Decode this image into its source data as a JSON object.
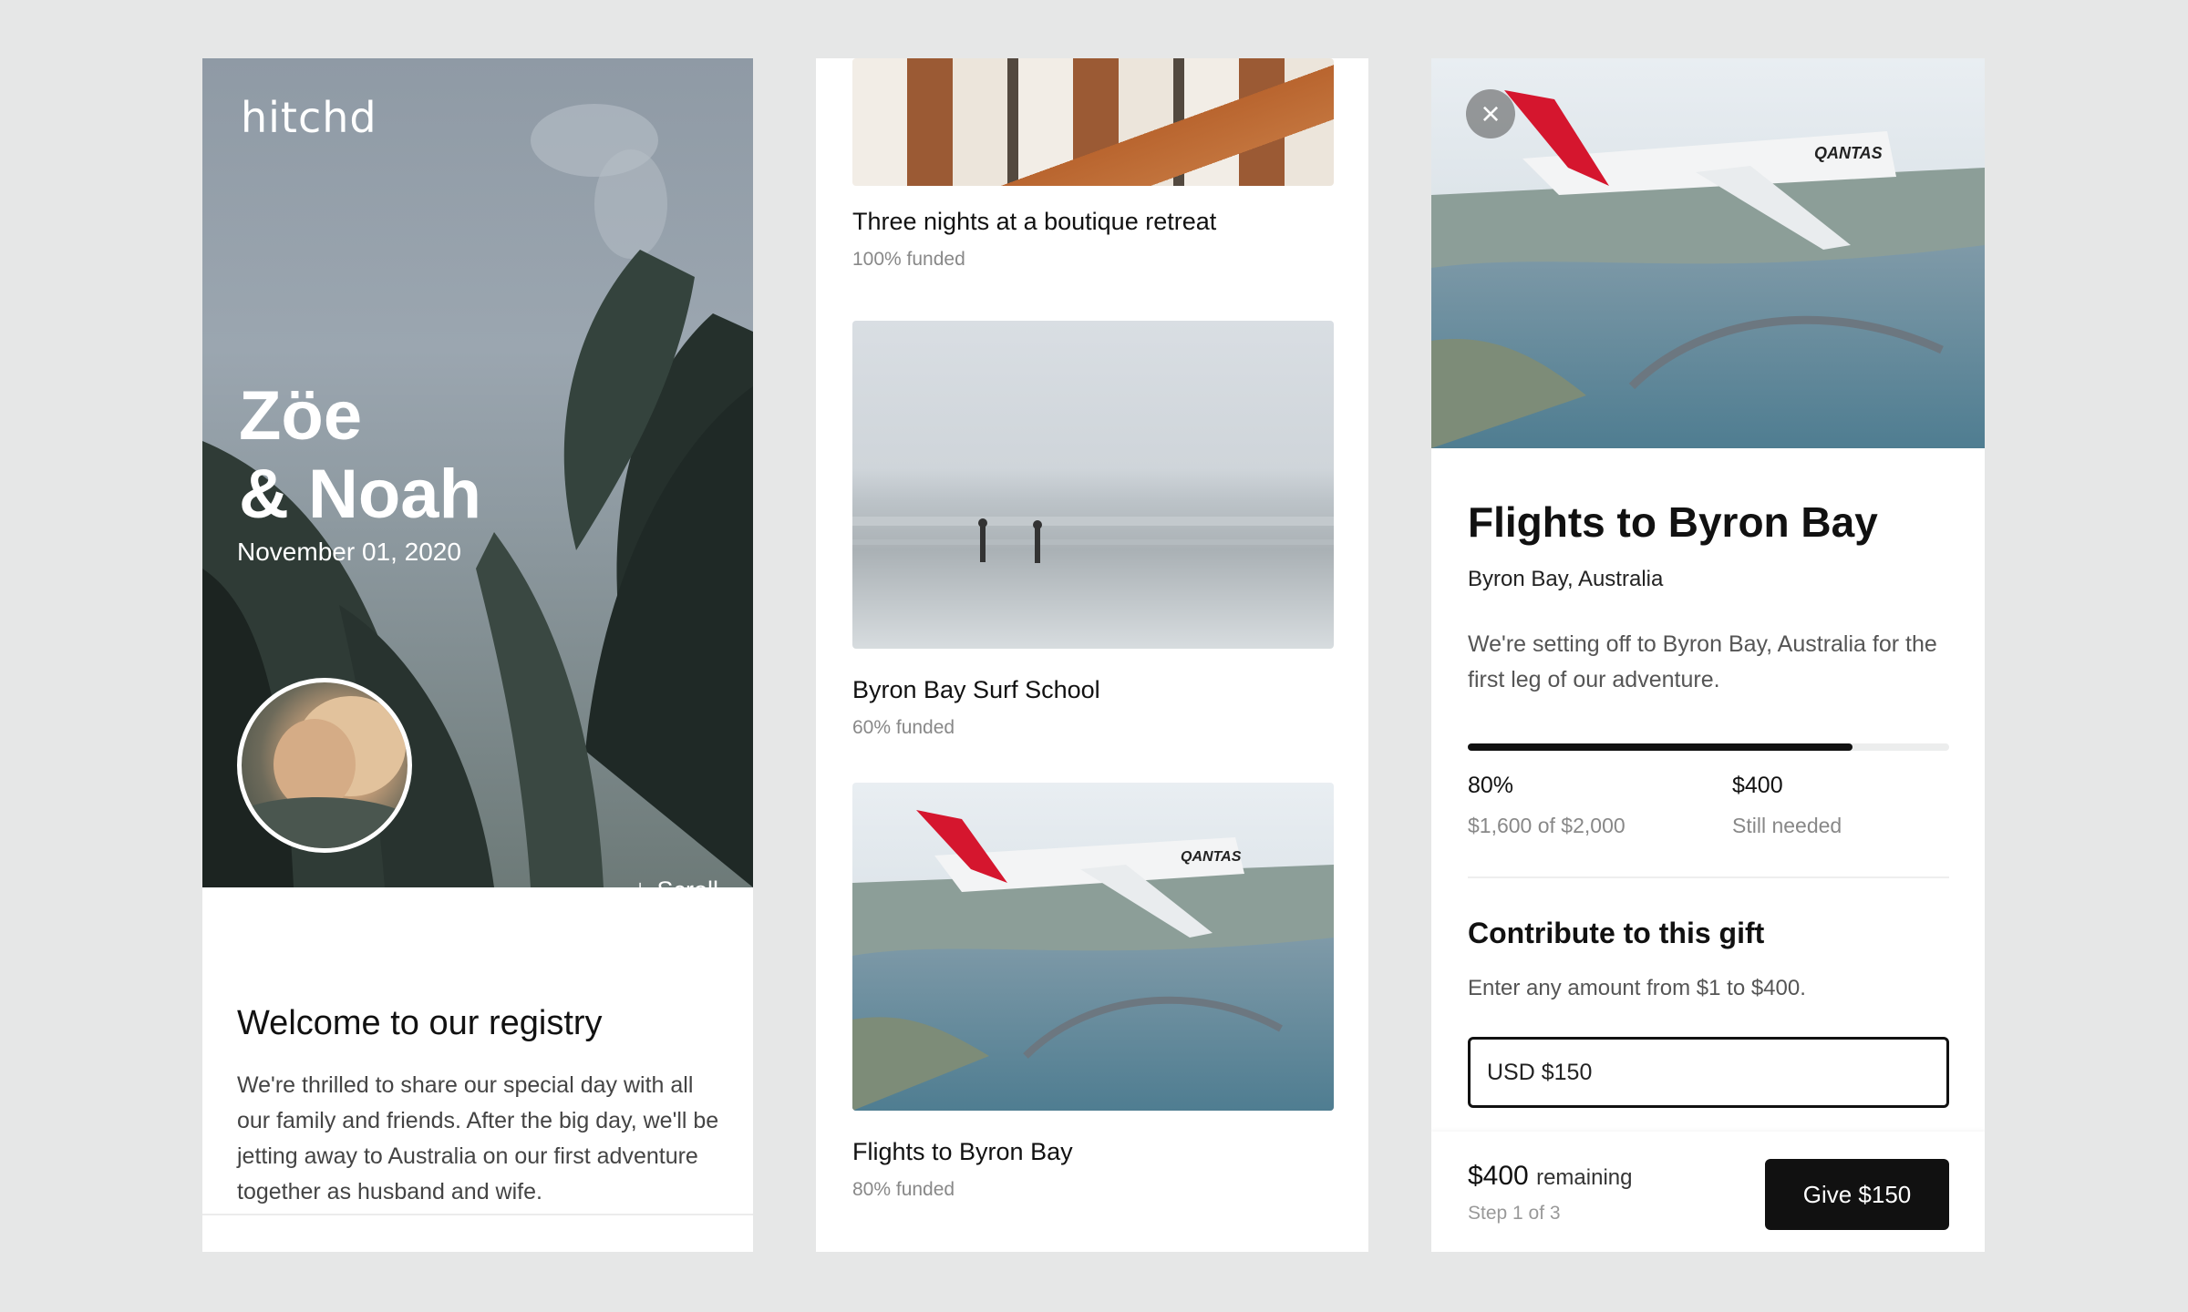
{
  "landing": {
    "logo": "hitchd",
    "couple_name": "Zöe\n& Noah",
    "date": "November 01, 2020",
    "scroll_label": "Scroll",
    "welcome_title": "Welcome to our registry",
    "welcome_body": "We're thrilled to share our special day with all our family and friends. After the big day, we'll be jetting away to Australia on our first adventure together as husband and wife."
  },
  "gifts": [
    {
      "name": "Three nights at a boutique retreat",
      "funded": "100% funded"
    },
    {
      "name": "Byron Bay Surf School",
      "funded": "60% funded"
    },
    {
      "name": "Flights to Byron Bay",
      "funded": "80% funded"
    }
  ],
  "detail": {
    "close_icon": "×",
    "title": "Flights to Byron Bay",
    "location": "Byron Bay, Australia",
    "description": "We're setting off to Byron Bay, Australia for the first leg of our adventure.",
    "progress_fraction": 0.8,
    "funded_percent": "80%",
    "funded_detail": "$1,600 of $2,000",
    "still_needed_amount": "$400",
    "still_needed_label": "Still needed",
    "contribute_title": "Contribute to this gift",
    "contribute_hint": "Enter any amount from $1 to $400.",
    "amount_value": "USD $150",
    "remaining_amount": "$400",
    "remaining_label": "remaining",
    "step": "Step 1 of 3",
    "give_button": "Give $150"
  },
  "airline_logo": "QANTAS",
  "colors": {
    "page_bg": "#e6e7e7",
    "qantas_red": "#d5162e",
    "button_bg": "#111111",
    "progress_fill": "#111111"
  }
}
